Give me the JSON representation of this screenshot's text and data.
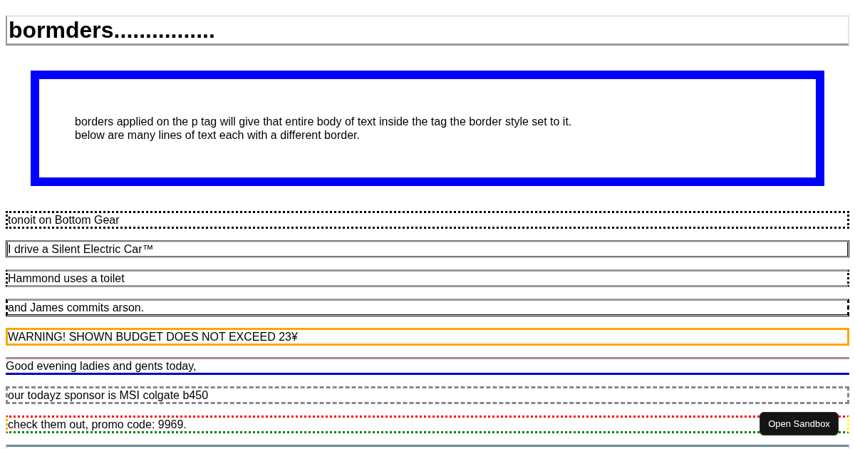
{
  "heading": "bormders................",
  "intro": [
    "borders applied on the p tag will give that entire body of text inside the tag the border style set to it.",
    "below are many lines of text each with a different border."
  ],
  "lines": [
    {
      "kind": "dotted",
      "text": "tonoit on Bottom Gear"
    },
    {
      "kind": "grooved",
      "text": "I drive a Silent Electric Car™"
    },
    {
      "kind": "mixed",
      "text": "Hammond uses a toilet"
    },
    {
      "kind": "framed",
      "text": "and James commits arson."
    },
    {
      "kind": "warning",
      "text": "WARNING! SHOWN BUDGET DOES NOT EXCEED 23¥"
    },
    {
      "kind": "underlined",
      "text": "Good evening ladies and gents today,"
    },
    {
      "kind": "dashed",
      "text": "our todayz sponsor is MSI colgate b450"
    },
    {
      "kind": "rainbow",
      "text": "check them out, promo code: 9969."
    },
    {
      "kind": "clipped"
    }
  ],
  "sandbox_button": "Open Sandbox"
}
